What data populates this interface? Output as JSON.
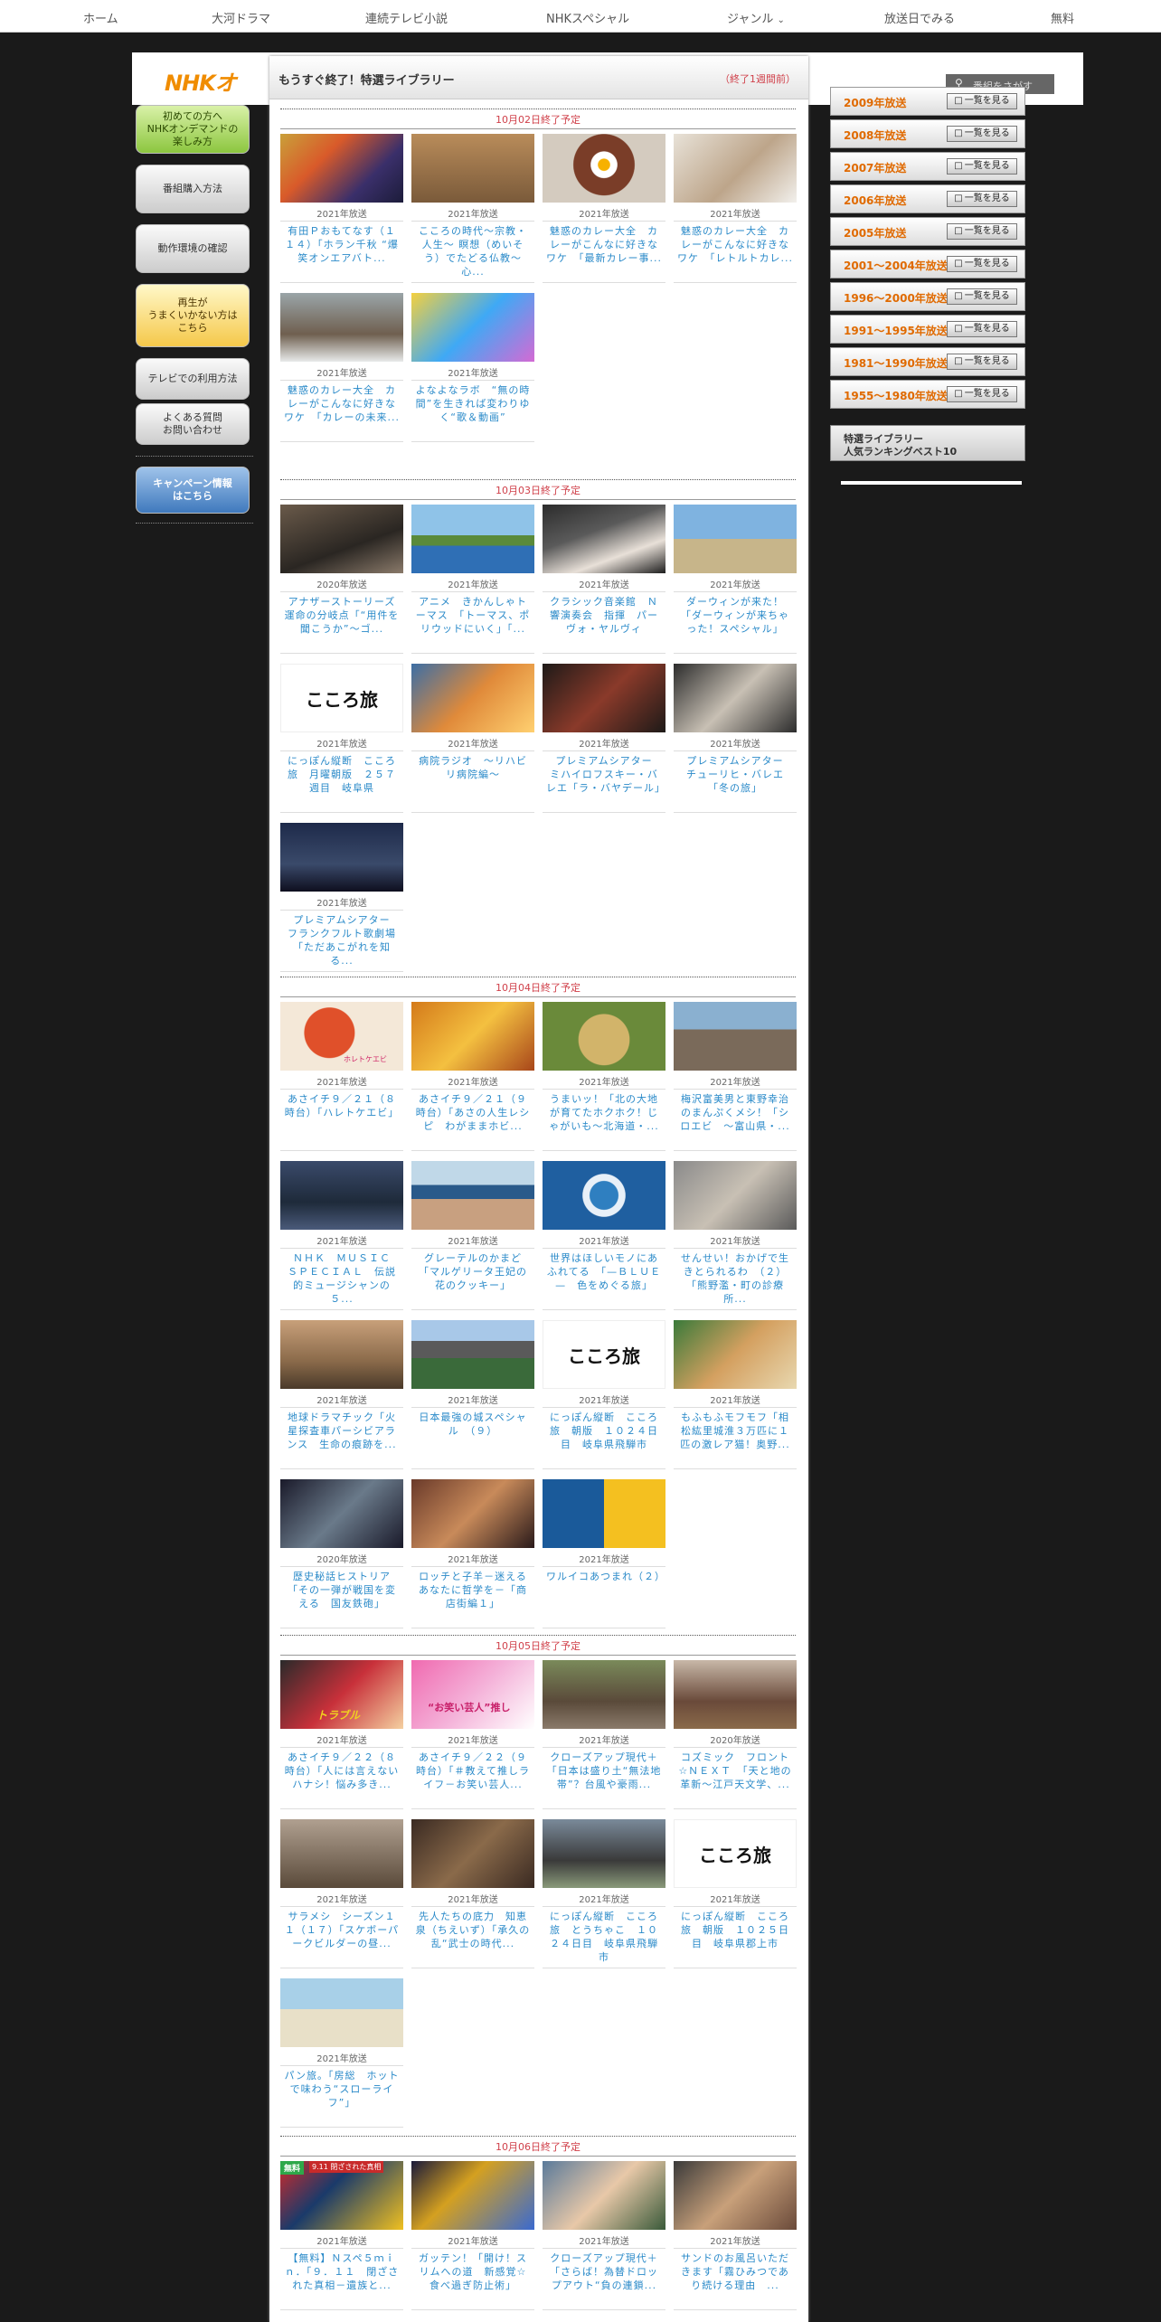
{
  "nav": {
    "items": [
      "ホーム",
      "大河ドラマ",
      "連続テレビ小説",
      "NHKスペシャル",
      "ジャンル",
      "放送日でみる",
      "無料"
    ]
  },
  "header": {
    "logo": "NHKオ",
    "search_label": "番組をさがす"
  },
  "sidebar_left": {
    "items": [
      "初めての方へ\nNHKオンデマンドの\n楽しみ方",
      "番組購入方法",
      "動作環境の確認",
      "再生が\nうまくいかない方は\nこちら",
      "テレビでの利用方法",
      "よくある質問\nお問い合わせ",
      "キャンペーン情報\nはこちら"
    ]
  },
  "panel": {
    "title": "もうすぐ終了！特選ライブラリー",
    "note": "（終了1週間前）"
  },
  "days": [
    {
      "label": "10月02日終了予定",
      "cards": [
        {
          "year": "2021年放送",
          "title": "有田Ｐおもてなす（１１４）「ホラン千秋 “爆笑オンエアバト..."
        },
        {
          "year": "2021年放送",
          "title": "こころの時代～宗教・人生～ 瞑想（めいそう）でたどる仏教～心..."
        },
        {
          "year": "2021年放送",
          "title": "魅惑のカレー大全　カレーがこんなに好きなワケ　「最新カレー事..."
        },
        {
          "year": "2021年放送",
          "title": "魅惑のカレー大全　カレーがこんなに好きなワケ　「レトルトカレ..."
        },
        {
          "year": "2021年放送",
          "title": "魅惑のカレー大全　カレーがこんなに好きなワケ　「カレーの未来..."
        },
        {
          "year": "2021年放送",
          "title": "よなよなラボ　“無の時間”を生きれば変わりゆく“歌＆動画”"
        }
      ]
    },
    {
      "label": "10月03日終了予定",
      "cards": [
        {
          "year": "2020年放送",
          "title": "アナザーストーリーズ　運命の分岐点「“用件を聞こうか”～ゴ..."
        },
        {
          "year": "2021年放送",
          "title": "アニメ　きかんしゃトーマス　「トーマス、ポリウッドにいく」「..."
        },
        {
          "year": "2021年放送",
          "title": "クラシック音楽館　Ｎ響演奏会　指揮　パーヴォ・ヤルヴィ"
        },
        {
          "year": "2021年放送",
          "title": "ダーウィンが来た！「ダーウィンが来ちゃった！スペシャル」"
        },
        {
          "year": "2021年放送",
          "title": "にっぽん縦断　こころ旅　月曜朝版　２５７週目　岐阜県"
        },
        {
          "year": "2021年放送",
          "title": "病院ラジオ　～リハビリ病院編～"
        },
        {
          "year": "2021年放送",
          "title": "プレミアムシアター　ミハイロフスキー・バレエ「ラ・バヤデール」"
        },
        {
          "year": "2021年放送",
          "title": "プレミアムシアター　チューリヒ・バレエ「冬の旅」"
        },
        {
          "year": "2021年放送",
          "title": "プレミアムシアター　フランクフルト歌劇場「ただあこがれを知る..."
        }
      ]
    },
    {
      "label": "10月04日終了予定",
      "cards": [
        {
          "year": "2021年放送",
          "title": "あさイチ９／２１（８時台）「ハレトケエビ」"
        },
        {
          "year": "2021年放送",
          "title": "あさイチ９／２１（９時台）「あさの人生レシピ　わがままホビ..."
        },
        {
          "year": "2021年放送",
          "title": "うまいッ！「北の大地が育てたホクホク！じゃがいも～北海道・..."
        },
        {
          "year": "2021年放送",
          "title": "梅沢富美男と東野幸治のまんぷくメシ！「シロエビ　～富山県・..."
        },
        {
          "year": "2021年放送",
          "title": "ＮＨＫ　ＭＵＳＩＣ　ＳＰＥＣＩＡＬ　伝説的ミュージシャンの５..."
        },
        {
          "year": "2021年放送",
          "title": "グレーテルのかまど「マルゲリータ王妃の花のクッキー」"
        },
        {
          "year": "2021年放送",
          "title": "世界はほしいモノにあふれてる　「—ＢＬＵＥ—　色をめぐる旅」"
        },
        {
          "year": "2021年放送",
          "title": "せんせい！おかげで生きとられるわ　（２）「熊野濫・町の診療所..."
        },
        {
          "year": "2021年放送",
          "title": "地球ドラマチック「火星探査車パーシビアランス　生命の痕跡を..."
        },
        {
          "year": "2021年放送",
          "title": "日本最強の城スペシャル　（９）"
        },
        {
          "year": "2021年放送",
          "title": "にっぽん縦断　こころ旅　朝版　１０２４日目　岐阜県飛騨市"
        },
        {
          "year": "2021年放送",
          "title": "もふもふモフモフ「相松紘里城淮３万匹に１匹の激レア猫！奥野..."
        },
        {
          "year": "2020年放送",
          "title": "歴史秘話ヒストリア「その一弾が戦国を変える　国友鉄砲」"
        },
        {
          "year": "2021年放送",
          "title": "ロッチと子羊－迷えるあなたに哲学を－「商店街編１」"
        },
        {
          "year": "2021年放送",
          "title": "ワルイコあつまれ（２）"
        }
      ]
    },
    {
      "label": "10月05日終了予定",
      "cards": [
        {
          "year": "2021年放送",
          "title": "あさイチ９／２２（８時台）「人には言えないハナシ！悩み多き..."
        },
        {
          "year": "2021年放送",
          "title": "あさイチ９／２２（９時台）「＃教えて推しライフ－お笑い芸人..."
        },
        {
          "year": "2021年放送",
          "title": "クローズアップ現代＋「日本は盛り土“無法地帯”？台風や豪雨..."
        },
        {
          "year": "2020年放送",
          "title": "コズミック　フロント☆ＮＥＸＴ　「天と地の革新～江戸天文学、..."
        },
        {
          "year": "2021年放送",
          "title": "サラメシ　シーズン１１（１７）「スケボーパークビルダーの昼..."
        },
        {
          "year": "2021年放送",
          "title": "先人たちの底力　知恵泉（ちえいず）「承久の乱“武士の時代..."
        },
        {
          "year": "2021年放送",
          "title": "にっぽん縦断　こころ旅　とうちゃこ　１０２４日目　岐阜県飛騨市"
        },
        {
          "year": "2021年放送",
          "title": "にっぽん縦断　こころ旅　朝版　１０２５日目　岐阜県郡上市"
        },
        {
          "year": "2021年放送",
          "title": "パン旅。「房総　ホットで味わう“スローライフ”」"
        }
      ]
    },
    {
      "label": "10月06日終了予定",
      "cards": [
        {
          "year": "2021年放送",
          "title": "【無料】Ｎスペ５ｍｉｎ．「９．１１　閉ざされた真相－遺族と..."
        },
        {
          "year": "2021年放送",
          "title": "ガッテン！「開け！スリムへの道　新感覚☆食べ過ぎ防止術」"
        },
        {
          "year": "2021年放送",
          "title": "クローズアップ現代＋「さらば！為替ドロップアウト“負の連鎖..."
        },
        {
          "year": "2021年放送",
          "title": "サンドのお風呂いただきます「霧ひみつであり続ける理由　..."
        }
      ]
    }
  ],
  "thumb_overlays": {
    "kokoro": "こころ旅",
    "free_badge": "無料",
    "free_banner": "9.11 閉ざされた真相",
    "variety": "“お笑い芸人”推し",
    "shrimp": "ホレトケエビ",
    "hashtag": "トラブル"
  },
  "sidebar_right": {
    "view_label": "一覧を見る",
    "years": [
      "2009年放送",
      "2008年放送",
      "2007年放送",
      "2006年放送",
      "2005年放送",
      "2001〜2004年放送",
      "1996〜2000年放送",
      "1991〜1995年放送",
      "1981〜1990年放送",
      "1955〜1980年放送"
    ],
    "ranking_line1": "特選ライブラリー",
    "ranking_line2": "人気ランキングベスト10"
  },
  "colors": {
    "accent_red": "#d0404a",
    "link_blue": "#2a8ac9",
    "logo_orange": "#f08c00",
    "year_orange": "#e06a00"
  }
}
